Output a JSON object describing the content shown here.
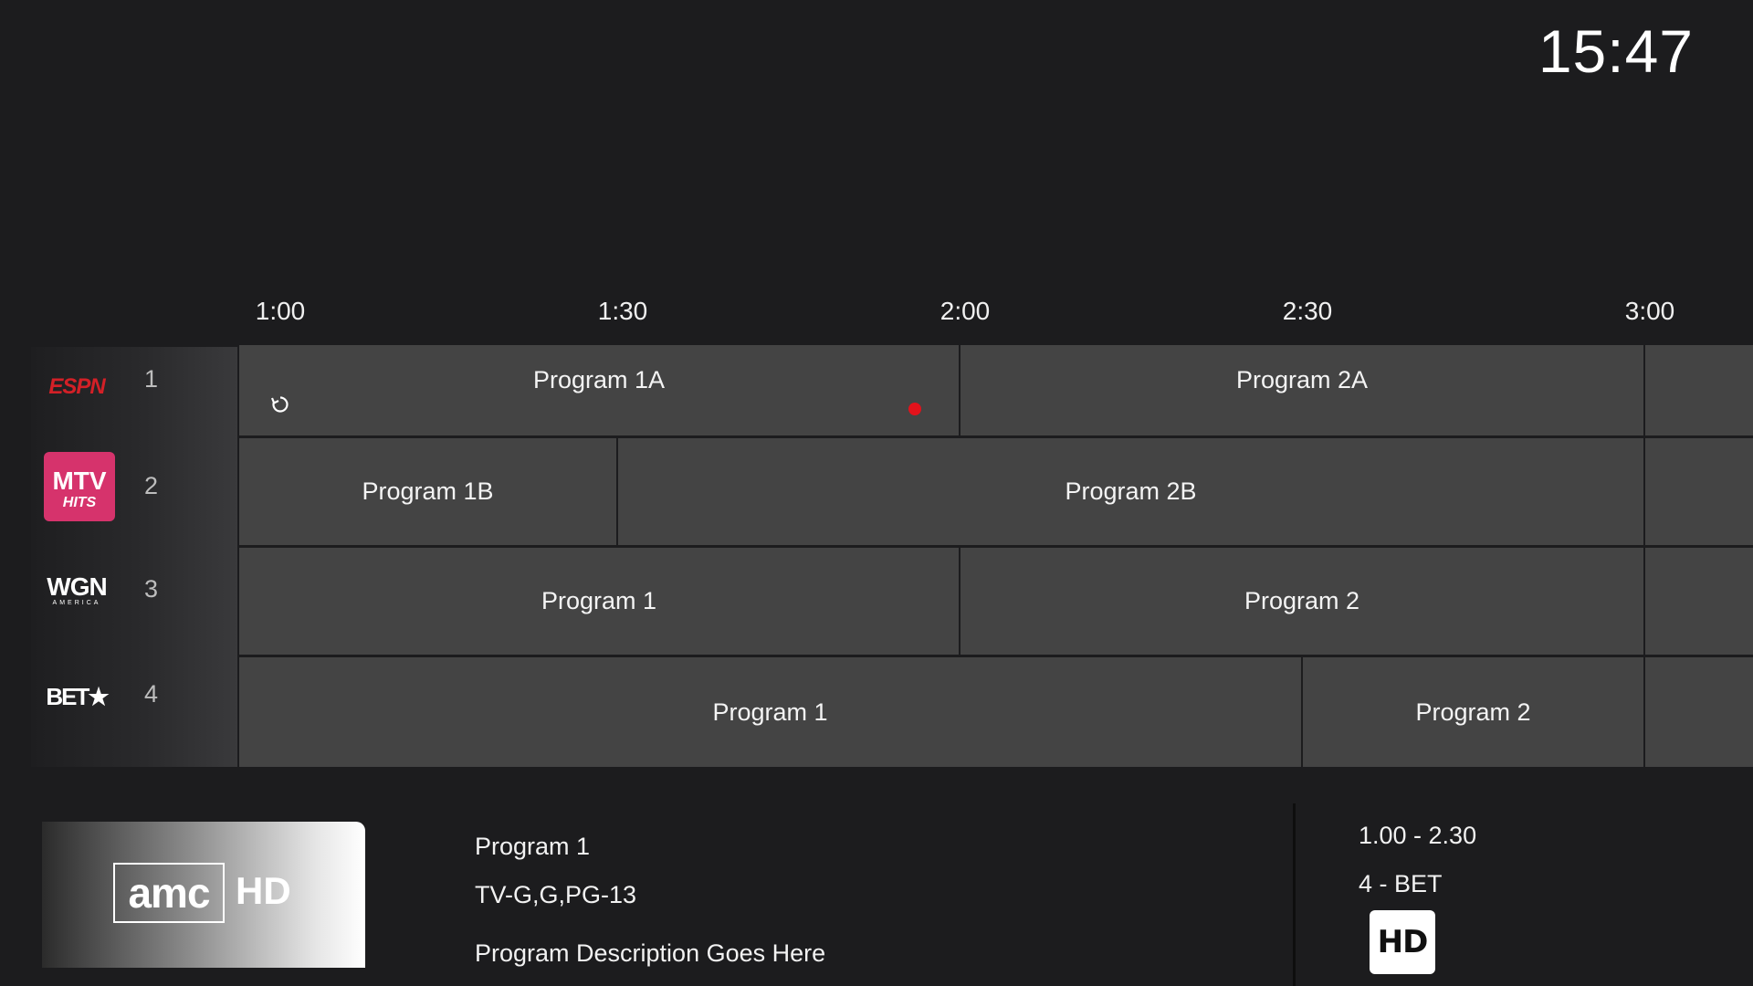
{
  "clock": "15:47",
  "timeline": [
    "1:00",
    "1:30",
    "2:00",
    "2:30",
    "3:00"
  ],
  "channels": [
    {
      "number": "1",
      "logo_text": "ESPN",
      "logo_icon": "espn-logo"
    },
    {
      "number": "2",
      "logo_text": "MTV",
      "logo_subtext": "HITS",
      "logo_icon": "mtv-hits-logo"
    },
    {
      "number": "3",
      "logo_text": "WGN",
      "logo_subtext": "AMERICA",
      "logo_icon": "wgn-america-logo"
    },
    {
      "number": "4",
      "logo_text": "BET★",
      "logo_icon": "bet-logo"
    }
  ],
  "programs": {
    "row1": [
      "Program 1A",
      "Program 2A"
    ],
    "row2": [
      "Program 1B",
      "Program 2B"
    ],
    "row3": [
      "Program 1",
      "Program 2"
    ],
    "row4": [
      "Program 1",
      "Program 2"
    ]
  },
  "selected": {
    "thumb_brand": "amc",
    "thumb_hd": "HD",
    "title": "Program 1",
    "ratings": "TV-G,G,PG-13",
    "description": "Program Description Goes Here",
    "time_range": "1.00 - 2.30",
    "channel": "4 - BET",
    "quality_badge": "HD"
  },
  "colors": {
    "background": "#1c1c1e",
    "cell": "#444444",
    "recording": "#e3121b",
    "mtv_pink": "#d6336c",
    "espn_red": "#d32027"
  }
}
